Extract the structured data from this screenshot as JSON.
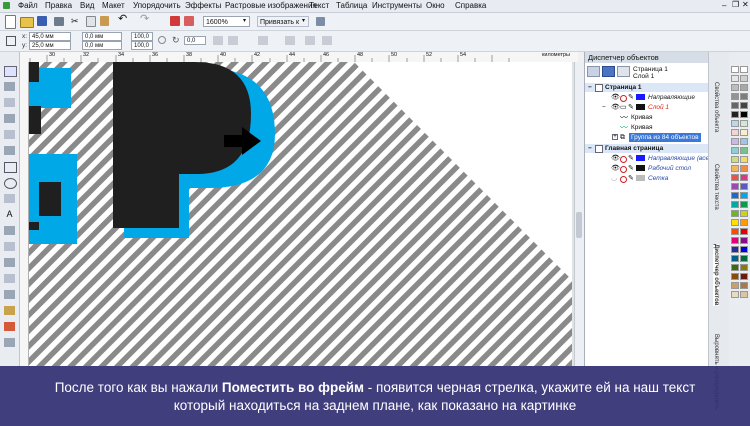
{
  "menu": [
    "Файл",
    "Правка",
    "Вид",
    "Макет",
    "Упорядочить",
    "Эффекты",
    "Растровые изображения",
    "Текст",
    "Таблица",
    "Инструменты",
    "Окно",
    "Справка"
  ],
  "toolbar": {
    "zoom_value": "1600%",
    "snap_label": "Привязать к"
  },
  "property_bar": {
    "x_value": "45,0 мм",
    "y_value": "25,0 мм",
    "w_value": "0,0 мм",
    "h_value": "0,0 мм",
    "scale_w": "100,0",
    "scale_h": "100,0",
    "angle": "0,0"
  },
  "ruler": {
    "ticks": [
      "30",
      "32",
      "34",
      "36",
      "38",
      "40",
      "42",
      "44",
      "46",
      "48",
      "50",
      "52",
      "54"
    ],
    "unit": "километры"
  },
  "docker": {
    "title": "Диспетчер объектов",
    "header_page": "Страница 1",
    "header_layer": "Слой 1",
    "tree": [
      {
        "label": "Страница 1",
        "kind": "page"
      },
      {
        "label": "Направляющие",
        "kind": "layer"
      },
      {
        "label": "Слой 1",
        "kind": "layer-active"
      },
      {
        "label": "Кривая",
        "kind": "object"
      },
      {
        "label": "Кривая",
        "kind": "object"
      },
      {
        "label": "Группа из 84 объектов",
        "kind": "selected"
      },
      {
        "label": "Главная страница",
        "kind": "page"
      },
      {
        "label": "Направляющие (все ст",
        "kind": "master"
      },
      {
        "label": "Рабочий стол",
        "kind": "master"
      },
      {
        "label": "Сетка",
        "kind": "master"
      }
    ]
  },
  "side_tabs": [
    "Свойства объекта",
    "Свойства текста",
    "Диспетчер объектов",
    "Выровнять и распределить"
  ],
  "caption": {
    "line1_before": "После того как вы нажали ",
    "line1_bold": "Поместить во фрейм",
    "line1_after": " - появится черная стрелка, укажите ей на наш текст",
    "line2": "который находиться на заднем плане, как показано на картинке"
  },
  "colors": {
    "accent_blue": "#00a8e8",
    "letter_black": "#1f1f1f",
    "stripe_gray": "#8a8a8a",
    "caption_bg": "#34307a",
    "selection": "#3b78d8"
  }
}
